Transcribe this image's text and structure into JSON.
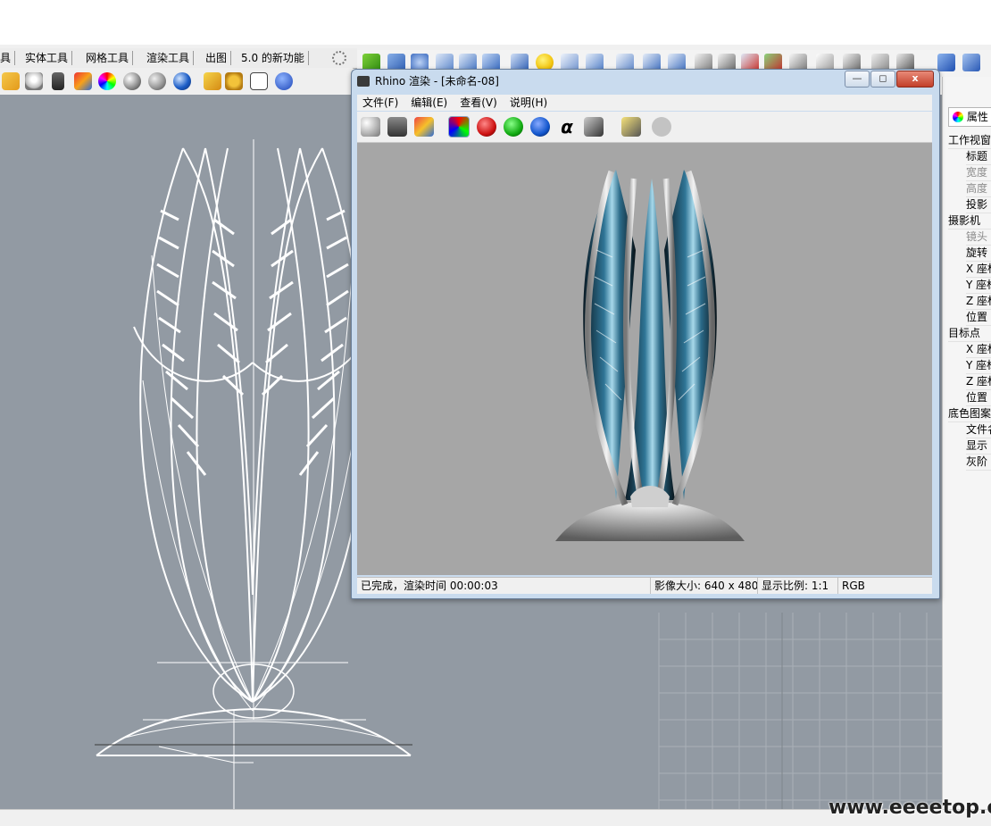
{
  "ribbon_tabs": [
    "具",
    "实体工具",
    "网格工具",
    "渲染工具",
    "出图",
    "5.0 的新功能"
  ],
  "render_window": {
    "title": "Rhino 渲染 - [未命名-08]",
    "menu": [
      "文件(F)",
      "编辑(E)",
      "查看(V)",
      "说明(H)"
    ],
    "minimize_glyph": "—",
    "restore_glyph": "◻",
    "close_glyph": "x",
    "status": {
      "message": "已完成，渲染时间 00:00:03",
      "image_size": "影像大小: 640 x 480",
      "display_ratio": "显示比例: 1:1",
      "color_mode": "RGB"
    }
  },
  "properties_panel": {
    "tab_label": "属性",
    "rows": [
      {
        "label": "工作视窗",
        "sub": false,
        "dim": false
      },
      {
        "label": "标题",
        "sub": true,
        "dim": false
      },
      {
        "label": "宽度",
        "sub": true,
        "dim": true
      },
      {
        "label": "高度",
        "sub": true,
        "dim": true
      },
      {
        "label": "投影",
        "sub": true,
        "dim": false
      },
      {
        "label": "摄影机",
        "sub": false,
        "dim": false
      },
      {
        "label": "镜头",
        "sub": true,
        "dim": true
      },
      {
        "label": "旋转",
        "sub": true,
        "dim": false
      },
      {
        "label": "X 座标",
        "sub": true,
        "dim": false
      },
      {
        "label": "Y 座标",
        "sub": true,
        "dim": false
      },
      {
        "label": "Z 座标",
        "sub": true,
        "dim": false
      },
      {
        "label": "位置",
        "sub": true,
        "dim": false
      },
      {
        "label": "目标点",
        "sub": false,
        "dim": false
      },
      {
        "label": "X 座标",
        "sub": true,
        "dim": false
      },
      {
        "label": "Y 座标",
        "sub": true,
        "dim": false
      },
      {
        "label": "Z 座标",
        "sub": true,
        "dim": false
      },
      {
        "label": "位置",
        "sub": true,
        "dim": false
      },
      {
        "label": "底色图案",
        "sub": false,
        "dim": false
      },
      {
        "label": "文件名",
        "sub": true,
        "dim": false
      },
      {
        "label": "显示",
        "sub": true,
        "dim": false
      },
      {
        "label": "灰阶",
        "sub": true,
        "dim": false
      }
    ]
  },
  "alpha_symbol": "α",
  "watermark": "www.eeeetop.com",
  "colors": {
    "viewport_bg": "#929aa3",
    "render_bg": "#a6a6a6",
    "window_frame": "#c9dbee"
  }
}
